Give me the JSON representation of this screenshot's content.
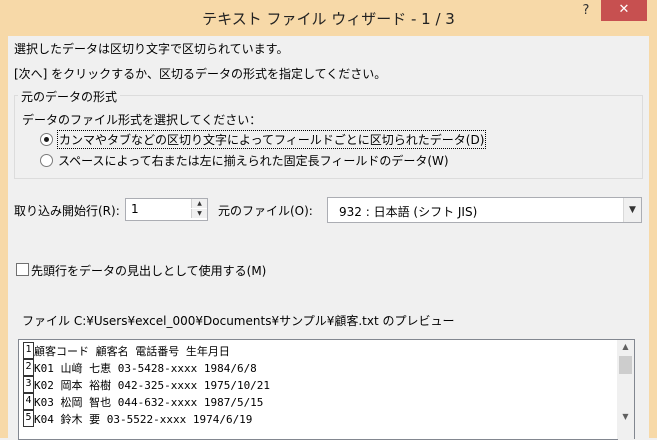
{
  "window": {
    "title": "テキスト ファイル ウィザード - 1 / 3",
    "help_label": "?",
    "close_label": "✕"
  },
  "intro": {
    "line1": "選択したデータは区切り文字で区切られています。",
    "line2": "[次へ] をクリックするか、区切るデータの形式を指定してください。"
  },
  "data_format": {
    "legend": "元のデータの形式",
    "prompt": "データのファイル形式を選択してください：",
    "options": [
      {
        "label": "カンマやタブなどの区切り文字によってフィールドごとに区切られたデータ(D)",
        "selected": true
      },
      {
        "label": "スペースによって右または左に揃えられた固定長フィールドのデータ(W)",
        "selected": false
      }
    ]
  },
  "start_row": {
    "label": "取り込み開始行(R):",
    "value": "1"
  },
  "origin": {
    "label": "元のファイル(O):",
    "value": "932 : 日本語 (シフト JIS)"
  },
  "header_checkbox": {
    "label": "先頭行をデータの見出しとして使用する(M)",
    "checked": false
  },
  "preview": {
    "label": "ファイル C:¥Users¥excel_000¥Documents¥サンプル¥顧客.txt のプレビュー",
    "rows": [
      {
        "num": "1",
        "text": "顧客コード 顧客名 電話番号 生年月日"
      },
      {
        "num": "2",
        "text": "K01 山﨑  七恵 03-5428-xxxx 1984/6/8"
      },
      {
        "num": "3",
        "text": "K02 岡本  裕樹 042-325-xxxx 1975/10/21"
      },
      {
        "num": "4",
        "text": "K03 松岡  智也 044-632-xxxx 1987/5/15"
      },
      {
        "num": "5",
        "text": "K04 鈴木  要 03-5522-xxxx 1974/6/19"
      }
    ]
  },
  "colors": {
    "titlebar": "#f7d9a8",
    "close_button": "#c75050"
  }
}
